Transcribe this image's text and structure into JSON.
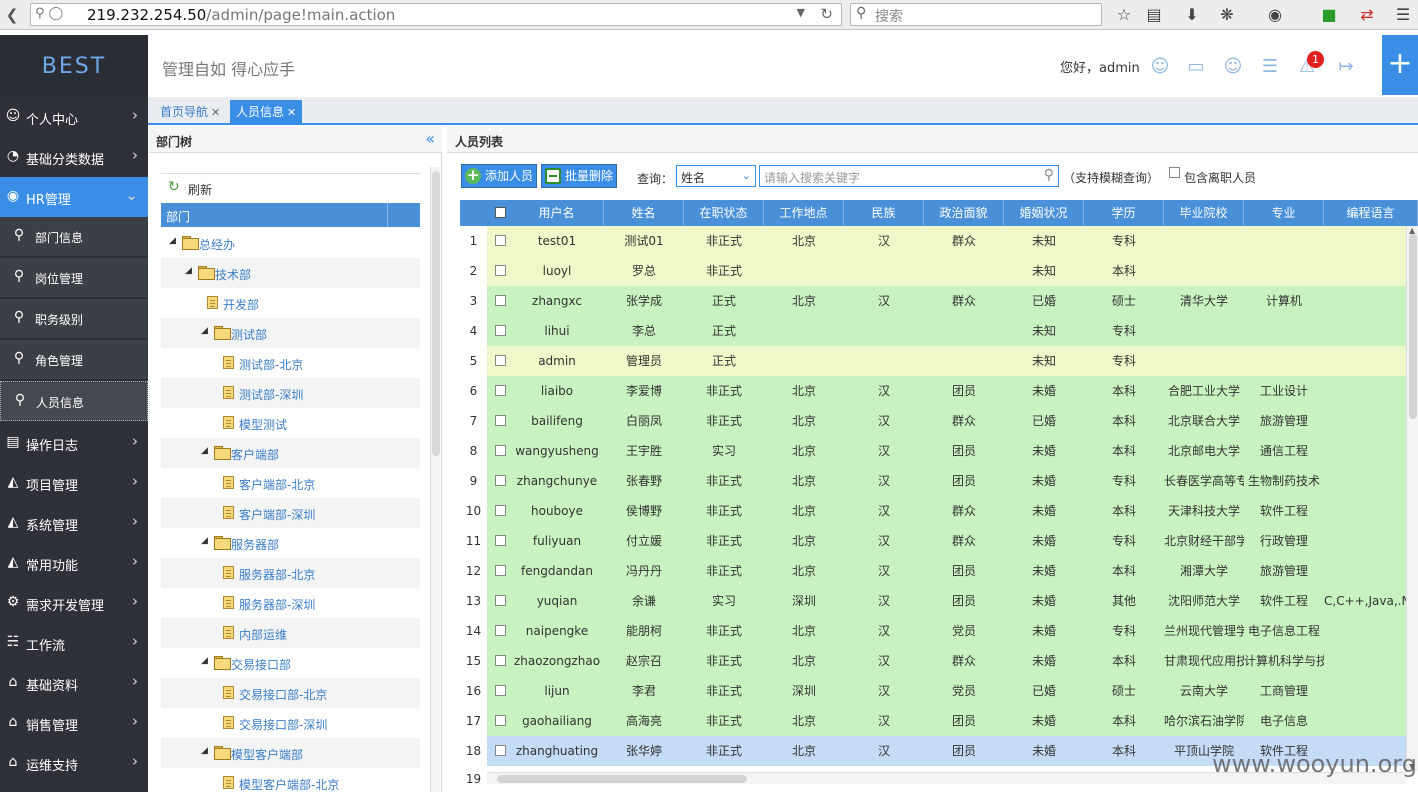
{
  "browser": {
    "url_host": "219.232.254.50",
    "url_path": "/admin/page!main.action",
    "search_placeholder": "搜索"
  },
  "logo": "BEST",
  "sidebar": {
    "items": [
      {
        "label": "个人中心",
        "icon": "user-icon"
      },
      {
        "label": "基础分类数据",
        "icon": "dashboard-icon"
      },
      {
        "label": "HR管理",
        "icon": "globe-icon",
        "active": true
      },
      {
        "label": "操作日志",
        "icon": "log-icon"
      },
      {
        "label": "项目管理",
        "icon": "project-icon"
      },
      {
        "label": "系统管理",
        "icon": "system-icon"
      },
      {
        "label": "常用功能",
        "icon": "function-icon"
      },
      {
        "label": "需求开发管理",
        "icon": "gear-icon"
      },
      {
        "label": "工作流",
        "icon": "workflow-icon"
      },
      {
        "label": "基础资料",
        "icon": "home-icon"
      },
      {
        "label": "销售管理",
        "icon": "home-icon"
      },
      {
        "label": "运维支持",
        "icon": "home-icon"
      }
    ],
    "sub_items": [
      {
        "label": "部门信息"
      },
      {
        "label": "岗位管理"
      },
      {
        "label": "职务级别"
      },
      {
        "label": "角色管理"
      },
      {
        "label": "人员信息",
        "current": true
      }
    ]
  },
  "header": {
    "slogan": "管理自如 得心应手",
    "greeting": "您好，admin",
    "notification_count": "1"
  },
  "tabs": [
    {
      "label": "首页导航"
    },
    {
      "label": "人员信息",
      "active": true
    }
  ],
  "tree": {
    "title": "部门树",
    "refresh_label": "刷新",
    "column": "部门",
    "nodes": [
      {
        "label": "总经办",
        "level": 0,
        "type": "folder"
      },
      {
        "label": "技术部",
        "level": 1,
        "type": "folder"
      },
      {
        "label": "开发部",
        "level": 2,
        "type": "file"
      },
      {
        "label": "测试部",
        "level": 2,
        "type": "folder"
      },
      {
        "label": "测试部-北京",
        "level": 3,
        "type": "file"
      },
      {
        "label": "测试部-深圳",
        "level": 3,
        "type": "file"
      },
      {
        "label": "模型测试",
        "level": 3,
        "type": "file"
      },
      {
        "label": "客户端部",
        "level": 2,
        "type": "folder"
      },
      {
        "label": "客户端部-北京",
        "level": 3,
        "type": "file"
      },
      {
        "label": "客户端部-深圳",
        "level": 3,
        "type": "file"
      },
      {
        "label": "服务器部",
        "level": 2,
        "type": "folder"
      },
      {
        "label": "服务器部-北京",
        "level": 3,
        "type": "file"
      },
      {
        "label": "服务器部-深圳",
        "level": 3,
        "type": "file"
      },
      {
        "label": "内部运维",
        "level": 3,
        "type": "file"
      },
      {
        "label": "交易接口部",
        "level": 2,
        "type": "folder"
      },
      {
        "label": "交易接口部-北京",
        "level": 3,
        "type": "file"
      },
      {
        "label": "交易接口部-深圳",
        "level": 3,
        "type": "file"
      },
      {
        "label": "模型客户端部",
        "level": 2,
        "type": "folder"
      },
      {
        "label": "模型客户端部-北京",
        "level": 3,
        "type": "file"
      }
    ]
  },
  "list": {
    "title": "人员列表",
    "add_label": "添加人员",
    "batch_delete_label": "批量删除",
    "query_label": "查询：",
    "query_field": "姓名",
    "search_placeholder": "请输入搜索关键字",
    "fuzzy_hint": "（支持模糊查询）",
    "include_resigned_label": "包含离职人员",
    "columns": [
      "用户名",
      "姓名",
      "在职状态",
      "工作地点",
      "民族",
      "政治面貌",
      "婚姻状况",
      "学历",
      "毕业院校",
      "专业",
      "编程语言"
    ],
    "rows": [
      {
        "num": "1",
        "cells": [
          "test01",
          "测试01",
          "非正式",
          "北京",
          "汉",
          "群众",
          "未知",
          "专科",
          "",
          "",
          ""
        ],
        "style": "pending"
      },
      {
        "num": "2",
        "cells": [
          "luoyl",
          "罗总",
          "非正式",
          "",
          "",
          "",
          "未知",
          "本科",
          "",
          "",
          ""
        ],
        "style": "pending"
      },
      {
        "num": "3",
        "cells": [
          "zhangxc",
          "张学成",
          "正式",
          "北京",
          "汉",
          "群众",
          "已婚",
          "硕士",
          "清华大学",
          "计算机",
          ""
        ],
        "style": "normal"
      },
      {
        "num": "4",
        "cells": [
          "lihui",
          "李总",
          "正式",
          "",
          "",
          "",
          "未知",
          "专科",
          "",
          "",
          ""
        ],
        "style": "normal"
      },
      {
        "num": "5",
        "cells": [
          "admin",
          "管理员",
          "正式",
          "",
          "",
          "",
          "未知",
          "专科",
          "",
          "",
          ""
        ],
        "style": "pending"
      },
      {
        "num": "6",
        "cells": [
          "liaibo",
          "李爱博",
          "非正式",
          "北京",
          "汉",
          "团员",
          "未婚",
          "本科",
          "合肥工业大学",
          "工业设计",
          ""
        ],
        "style": "normal"
      },
      {
        "num": "7",
        "cells": [
          "bailifeng",
          "白丽凤",
          "非正式",
          "北京",
          "汉",
          "群众",
          "已婚",
          "本科",
          "北京联合大学",
          "旅游管理",
          ""
        ],
        "style": "normal"
      },
      {
        "num": "8",
        "cells": [
          "wangyusheng",
          "王宇胜",
          "实习",
          "北京",
          "汉",
          "团员",
          "未婚",
          "本科",
          "北京邮电大学",
          "通信工程",
          ""
        ],
        "style": "normal"
      },
      {
        "num": "9",
        "cells": [
          "zhangchunye",
          "张春野",
          "非正式",
          "北京",
          "汉",
          "团员",
          "未婚",
          "专科",
          "长春医学高等专",
          "生物制药技术",
          ""
        ],
        "style": "normal"
      },
      {
        "num": "10",
        "cells": [
          "houboye",
          "侯博野",
          "非正式",
          "北京",
          "汉",
          "群众",
          "未婚",
          "本科",
          "天津科技大学",
          "软件工程",
          ""
        ],
        "style": "normal"
      },
      {
        "num": "11",
        "cells": [
          "fuliyuan",
          "付立媛",
          "非正式",
          "北京",
          "汉",
          "群众",
          "未婚",
          "专科",
          "北京财经干部学",
          "行政管理",
          ""
        ],
        "style": "normal"
      },
      {
        "num": "12",
        "cells": [
          "fengdandan",
          "冯丹丹",
          "非正式",
          "北京",
          "汉",
          "团员",
          "未婚",
          "本科",
          "湘潭大学",
          "旅游管理",
          ""
        ],
        "style": "normal"
      },
      {
        "num": "13",
        "cells": [
          "yuqian",
          "余谦",
          "实习",
          "深圳",
          "汉",
          "团员",
          "未婚",
          "其他",
          "沈阳师范大学",
          "软件工程",
          "C,C++,Java,.NET"
        ],
        "style": "normal"
      },
      {
        "num": "14",
        "cells": [
          "naipengke",
          "能朋柯",
          "非正式",
          "北京",
          "汉",
          "党员",
          "未婚",
          "专科",
          "兰州现代管理学",
          "电子信息工程",
          ""
        ],
        "style": "normal"
      },
      {
        "num": "15",
        "cells": [
          "zhaozongzhao",
          "赵宗召",
          "非正式",
          "北京",
          "汉",
          "群众",
          "未婚",
          "本科",
          "甘肃现代应用技",
          "计算机科学与技",
          ""
        ],
        "style": "normal"
      },
      {
        "num": "16",
        "cells": [
          "lijun",
          "李君",
          "非正式",
          "深圳",
          "汉",
          "党员",
          "已婚",
          "硕士",
          "云南大学",
          "工商管理",
          ""
        ],
        "style": "normal"
      },
      {
        "num": "17",
        "cells": [
          "gaohailiang",
          "高海亮",
          "非正式",
          "北京",
          "汉",
          "团员",
          "未婚",
          "本科",
          "哈尔滨石油学院",
          "电子信息",
          ""
        ],
        "style": "normal"
      },
      {
        "num": "18",
        "cells": [
          "zhanghuating",
          "张华婷",
          "非正式",
          "北京",
          "汉",
          "团员",
          "未婚",
          "本科",
          "平顶山学院",
          "软件工程",
          ""
        ],
        "style": "selected"
      }
    ],
    "next_row_num": "19"
  },
  "watermark": "www.wooyun.org"
}
